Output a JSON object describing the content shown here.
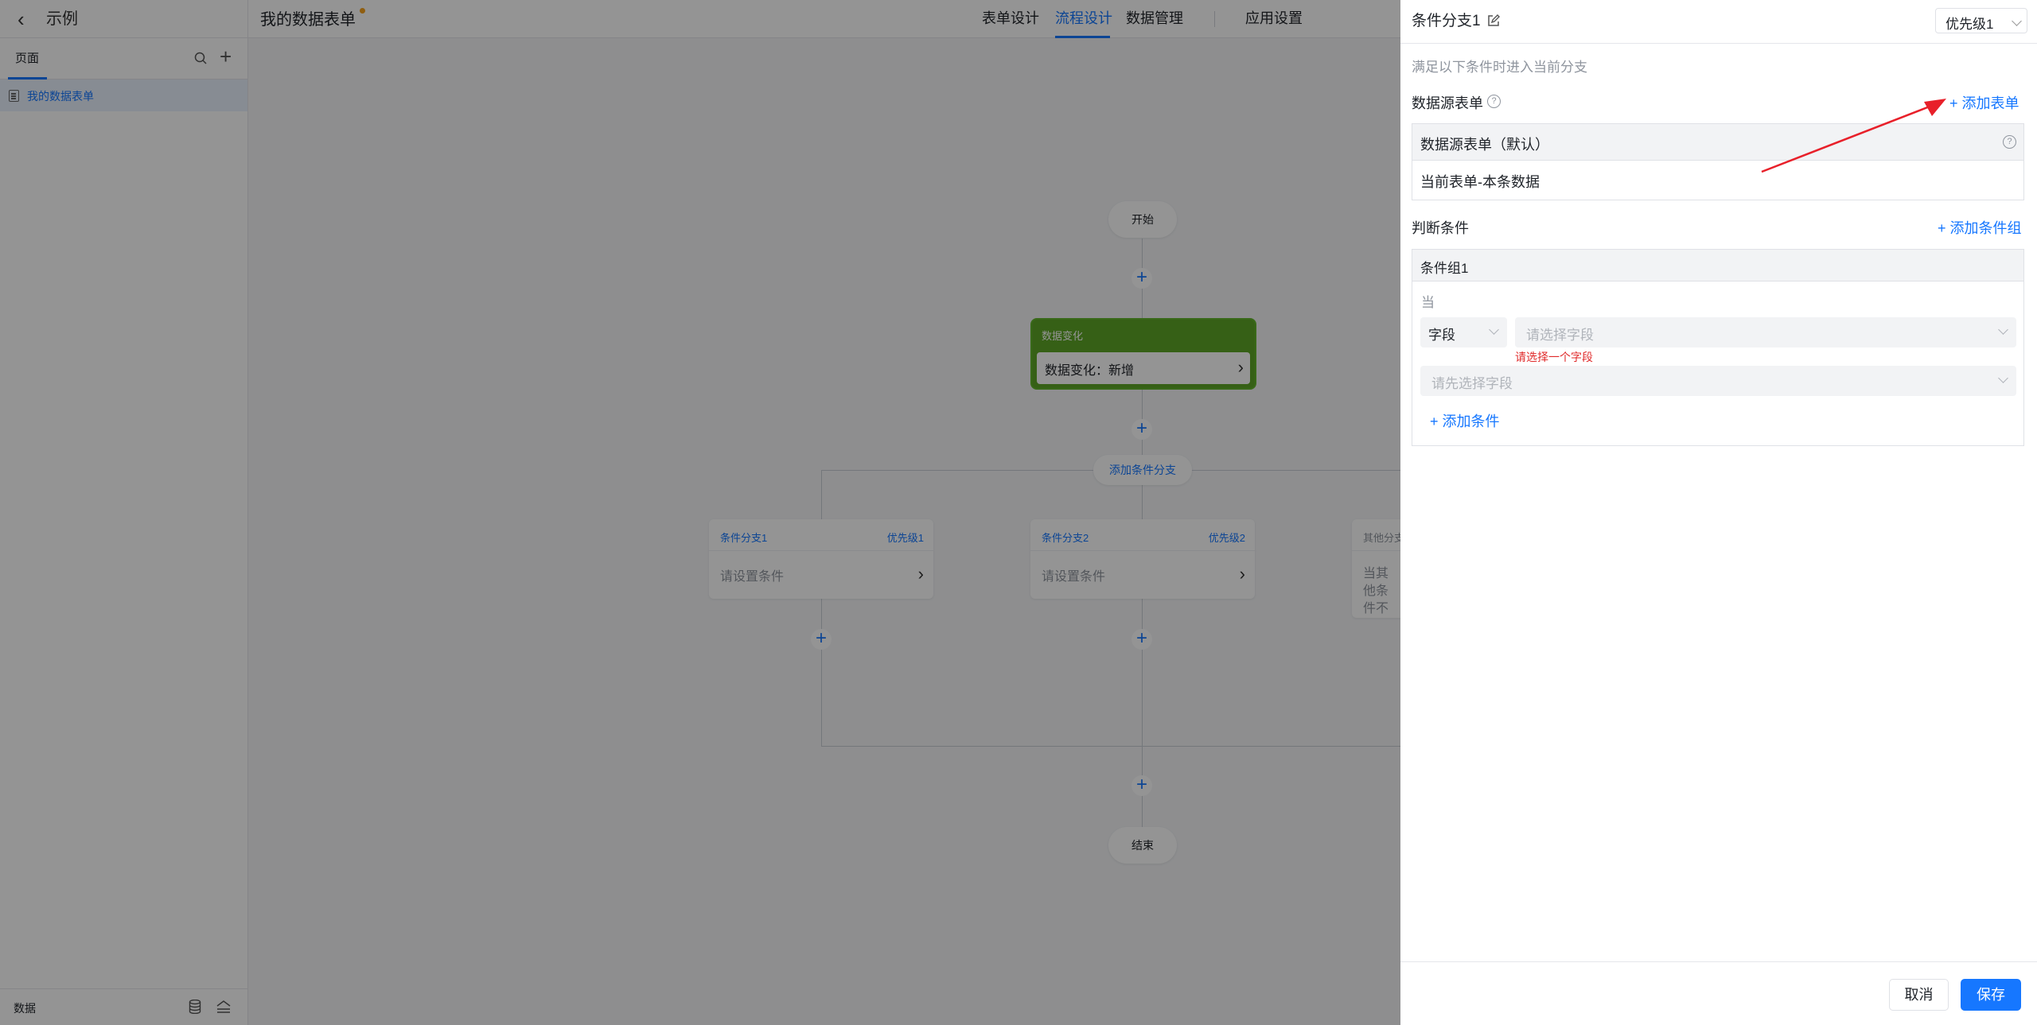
{
  "header": {
    "back_icon": "chevron-left-icon",
    "app_name": "示例",
    "form_title": "我的数据表单",
    "tabs": [
      "表单设计",
      "流程设计",
      "数据管理",
      "应用设置"
    ],
    "active_tab": "流程设计",
    "unsaved_dot_color": "#f7a21c"
  },
  "sidebar": {
    "tab_label": "页面",
    "items": [
      {
        "label": "我的数据表单",
        "icon": "document-icon"
      }
    ],
    "footer_label": "数据"
  },
  "canvas": {
    "start_label": "开始",
    "trigger": {
      "title": "数据变化",
      "value": "数据变化：新增"
    },
    "add_branch_label": "添加条件分支",
    "branches": [
      {
        "name": "条件分支1",
        "priority": "优先级1",
        "body": "请设置条件"
      },
      {
        "name": "条件分支2",
        "priority": "优先级2",
        "body": "请设置条件"
      },
      {
        "name": "其他分支",
        "priority": "",
        "body": "当其他条件不满足时，进入该分支"
      }
    ],
    "end_label": "结束"
  },
  "panel": {
    "title": "条件分支1",
    "priority_select": "优先级1",
    "hint": "满足以下条件时进入当前分支",
    "datasource": {
      "label": "数据源表单",
      "add_link": "添加表单",
      "table_header": "数据源表单（默认）",
      "row": "当前表单-本条数据"
    },
    "condition": {
      "label": "判断条件",
      "add_group_link": "添加条件组",
      "group_title": "条件组1",
      "when_label": "当",
      "type_select": "字段",
      "field_placeholder": "请选择字段",
      "error": "请选择一个字段",
      "value_placeholder": "请先选择字段",
      "add_condition": "添加条件"
    },
    "buttons": {
      "cancel": "取消",
      "save": "保存"
    },
    "colors": {
      "primary": "#1677ff",
      "error": "#e02b2b",
      "trigger_green": "#5da627"
    }
  }
}
